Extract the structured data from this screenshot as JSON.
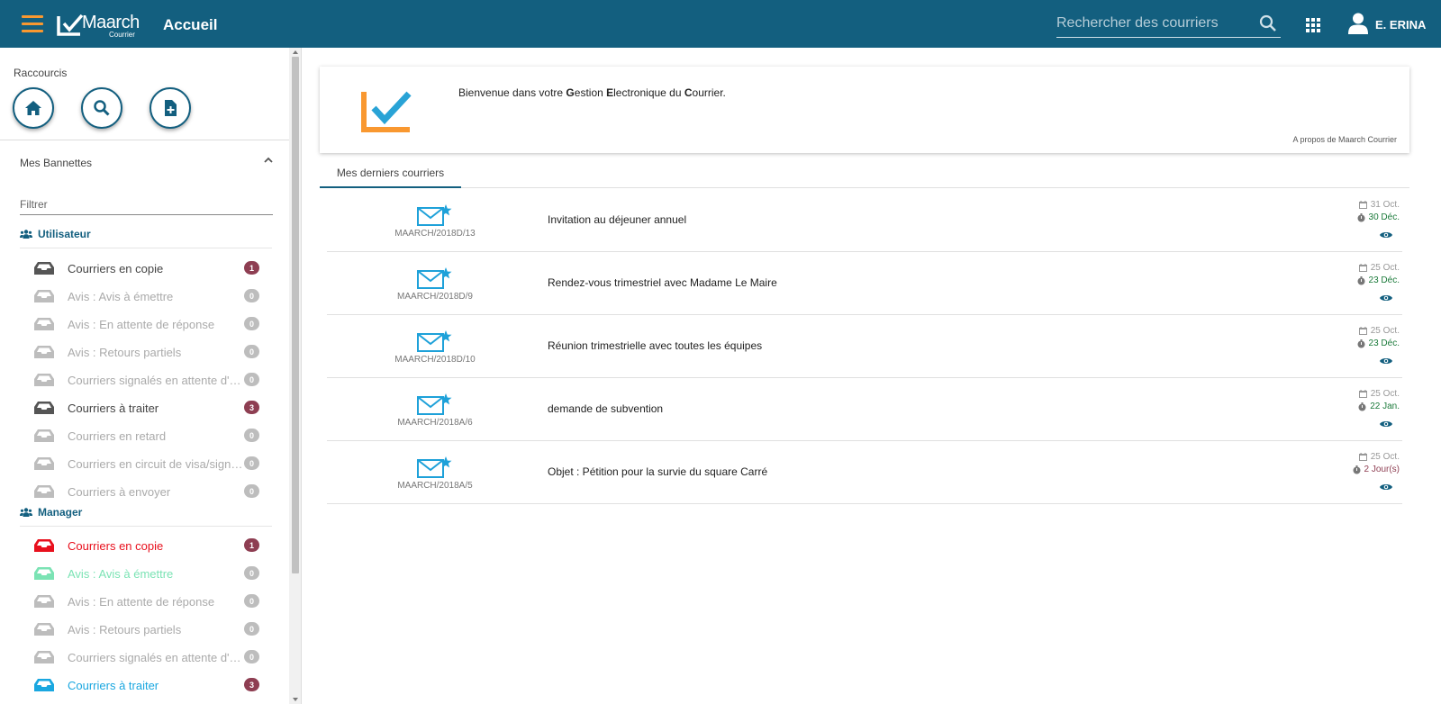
{
  "header": {
    "app_name": "Maarch",
    "app_subtitle": "Courrier",
    "page_title": "Accueil",
    "search_placeholder": "Rechercher des courriers",
    "user_name": "E. ERINA",
    "bg_color": "#135f7f",
    "accent_color": "#f99830"
  },
  "sidebar": {
    "shortcuts_title": "Raccourcis",
    "shortcuts": [
      {
        "icon": "home-icon"
      },
      {
        "icon": "search-icon"
      },
      {
        "icon": "new-document-icon"
      }
    ],
    "bannettes_title": "Mes Bannettes",
    "filter_placeholder": "Filtrer",
    "groups": [
      {
        "title": "Utilisateur",
        "baskets": [
          {
            "label": "Courriers en copie",
            "count": "1"
          },
          {
            "label": "Avis : Avis à émettre",
            "count": "0"
          },
          {
            "label": "Avis : En attente de réponse",
            "count": "0"
          },
          {
            "label": "Avis : Retours partiels",
            "count": "0"
          },
          {
            "label": "Courriers signalés en attente d'instruction",
            "count": "0"
          },
          {
            "label": "Courriers à traiter",
            "count": "3"
          },
          {
            "label": "Courriers en retard",
            "count": "0"
          },
          {
            "label": "Courriers en circuit de visa/signature",
            "count": "0"
          },
          {
            "label": "Courriers à envoyer",
            "count": "0"
          }
        ]
      },
      {
        "title": "Manager",
        "baskets": [
          {
            "label": "Courriers en copie",
            "count": "1"
          },
          {
            "label": "Avis : Avis à émettre",
            "count": "0"
          },
          {
            "label": "Avis : En attente de réponse",
            "count": "0"
          },
          {
            "label": "Avis : Retours partiels",
            "count": "0"
          },
          {
            "label": "Courriers signalés en attente d'instruction",
            "count": "0"
          },
          {
            "label": "Courriers à traiter",
            "count": "3"
          }
        ]
      }
    ]
  },
  "main": {
    "welcome_prefix": "Bienvenue dans votre ",
    "welcome_G": "G",
    "welcome_estion": "estion ",
    "welcome_E": "E",
    "welcome_lectronique": "lectronique du ",
    "welcome_C": "C",
    "welcome_ourrier": "ourrier.",
    "about_link": "A propos de Maarch Courrier",
    "tab_label": "Mes derniers courriers",
    "mails": [
      {
        "ref": "MAARCH/2018D/13",
        "subject": "Invitation au déjeuner annuel",
        "date": "31 Oct.",
        "limit": "30 Déc.",
        "limit_status": "ok"
      },
      {
        "ref": "MAARCH/2018D/9",
        "subject": "Rendez-vous trimestriel avec Madame Le Maire",
        "date": "25 Oct.",
        "limit": "23 Déc.",
        "limit_status": "ok"
      },
      {
        "ref": "MAARCH/2018D/10",
        "subject": "Réunion trimestrielle avec toutes les équipes",
        "date": "25 Oct.",
        "limit": "23 Déc.",
        "limit_status": "ok"
      },
      {
        "ref": "MAARCH/2018A/6",
        "subject": "demande de subvention",
        "date": "25 Oct.",
        "limit": "22 Jan.",
        "limit_status": "ok"
      },
      {
        "ref": "MAARCH/2018A/5",
        "subject": "Objet : Pétition pour la survie du square Carré",
        "date": "25 Oct.",
        "limit": "2 Jour(s)",
        "limit_status": "late"
      }
    ]
  }
}
